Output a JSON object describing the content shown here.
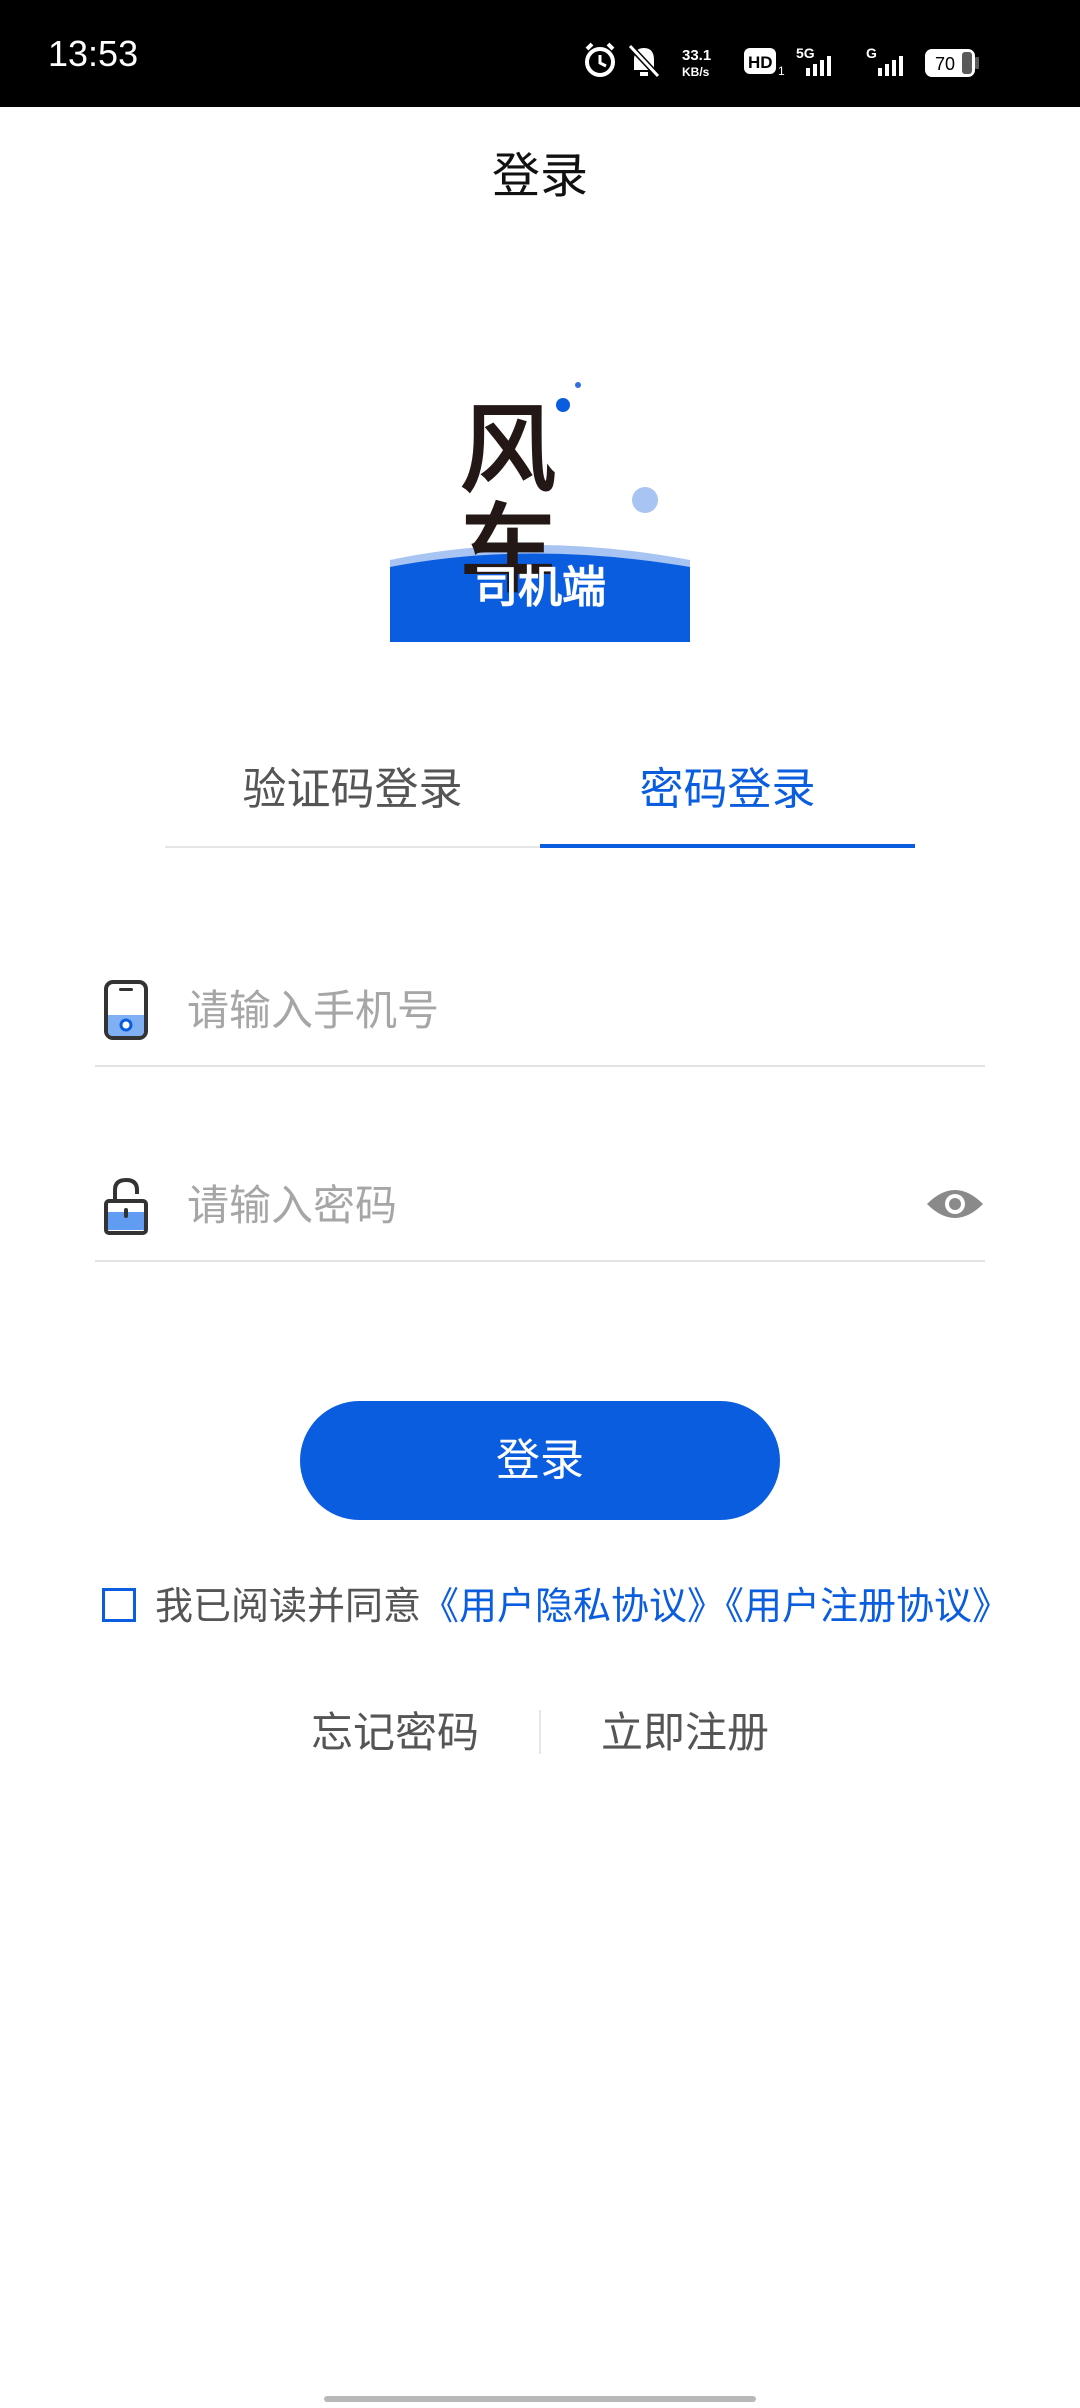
{
  "status_bar": {
    "time": "13:53",
    "network_speed_value": "33.1",
    "network_speed_unit": "KB/s",
    "hd_label": "HD",
    "sim1_label": "1",
    "network_5g_label": "5G",
    "network_g_label": "G",
    "battery_level": "70",
    "icons": [
      "alarm-icon",
      "bell-muted-icon",
      "hd-icon",
      "signal-5g-icon",
      "signal-g-icon",
      "battery-icon"
    ]
  },
  "header": {
    "title": "登录"
  },
  "logo": {
    "brand_text": "风车",
    "badge_text": "司机端",
    "colors": {
      "primary": "#0b5ddf",
      "light": "#a8c4f2",
      "dark": "#231815"
    }
  },
  "tabs": [
    {
      "label": "验证码登录",
      "active": false
    },
    {
      "label": "密码登录",
      "active": true
    }
  ],
  "form": {
    "phone_placeholder": "请输入手机号",
    "phone_value": "",
    "password_placeholder": "请输入密码",
    "password_value": "",
    "phone_icon": "phone-icon",
    "password_icon": "lock-open-icon",
    "visibility_icon": "eye-icon"
  },
  "login_button": {
    "label": "登录"
  },
  "agreement": {
    "checked": false,
    "text": "我已阅读并同意",
    "privacy_link": "《用户隐私协议》",
    "register_link": "《用户注册协议》"
  },
  "links": {
    "forgot_password": "忘记密码",
    "register_now": "立即注册"
  },
  "theme": {
    "accent": "#0b5ddf",
    "text_muted": "#555555",
    "placeholder": "#a6a6a6"
  }
}
